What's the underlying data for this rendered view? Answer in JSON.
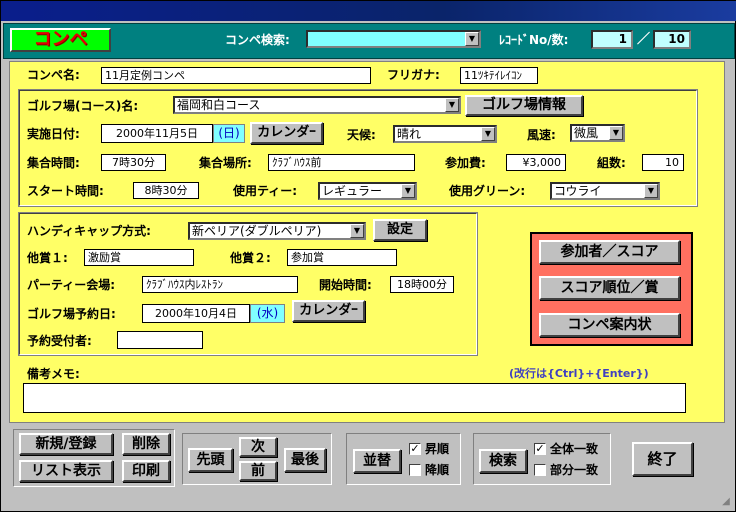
{
  "header": {
    "logo": "コンペ",
    "search_label": "コンペ検索:",
    "search_value": "",
    "record_label": "ﾚｺｰﾄﾞNo/数:",
    "record_no": "1",
    "separator": "／",
    "record_count": "10"
  },
  "form": {
    "compe_name_label": "コンペ名:",
    "compe_name": "11月定例コンペ",
    "furigana_label": "フリガナ:",
    "furigana": "11ﾂｷﾃｲﾚｲｺﾝ",
    "course_label": "ゴルフ場(コース)名:",
    "course": "福岡和白コース",
    "course_info_button": "ゴルフ場情報",
    "date_label": "実施日付:",
    "date": "2000年11月5日",
    "date_day": "(日)",
    "calendar_button": "カレンダｰ",
    "weather_label": "天候:",
    "weather": "晴れ",
    "wind_label": "風速:",
    "wind": "微風",
    "meet_time_label": "集合時間:",
    "meet_time": "7時30分",
    "meet_place_label": "集合場所:",
    "meet_place": "ｸﾗﾌﾞﾊｳｽ前",
    "fee_label": "参加費:",
    "fee": "¥3,000",
    "groups_label": "組数:",
    "groups": "10",
    "start_time_label": "スタート時間:",
    "start_time": "8時30分",
    "tee_label": "使用ティー:",
    "tee": "レギュラー",
    "green_label": "使用グリーン:",
    "green": "コウライ",
    "handicap_label": "ハンディキャップ方式:",
    "handicap": "新ペリア(ダブルペリア)",
    "settings_button": "設定",
    "prize1_label": "他賞１:",
    "prize1": "激励賞",
    "prize2_label": "他賞２:",
    "prize2": "参加賞",
    "party_label": "パーティー会場:",
    "party": "ｸﾗﾌﾞﾊｳｽ内ﾚｽﾄﾗﾝ",
    "party_start_label": "開始時間:",
    "party_start": "18時00分",
    "reserve_date_label": "ゴルフ場予約日:",
    "reserve_date": "2000年10月4日",
    "reserve_day": "(水)",
    "calendar_button2": "カレンダｰ",
    "receiver_label": "予約受付者:",
    "receiver": "",
    "memo_label": "備考メモ:",
    "memo_hint": "(改行は{Ctrl}+{Enter})",
    "memo": ""
  },
  "side_buttons": {
    "participants": "参加者／スコア",
    "ranking": "スコア順位／賞",
    "invitation": "コンペ案内状"
  },
  "footer": {
    "new": "新規/登録",
    "delete": "削除",
    "list": "リスト表示",
    "print": "印刷",
    "first": "先頭",
    "next": "次",
    "prev": "前",
    "last": "最後",
    "sort": "並替",
    "asc": "昇順",
    "desc": "降順",
    "search": "検索",
    "exact": "全体一致",
    "partial": "部分一致",
    "exit": "終了"
  },
  "state": {
    "asc_checked": true,
    "desc_checked": false,
    "exact_checked": true,
    "partial_checked": false
  },
  "colors": {
    "form_bg": "#ffff66",
    "header_bg": "#008080",
    "accent_box": "#ff7060",
    "logo_bg": "#00ff00"
  }
}
